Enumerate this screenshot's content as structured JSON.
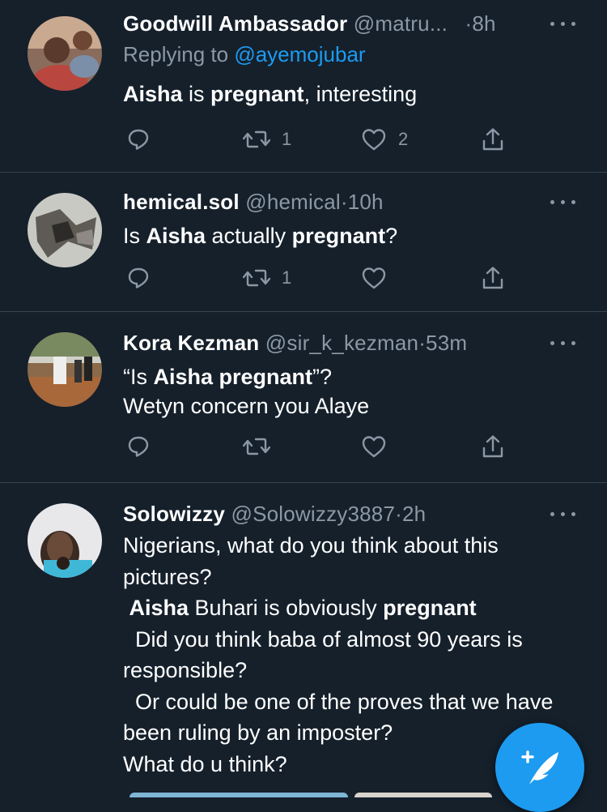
{
  "tweets": [
    {
      "name": "Goodwill Ambassador",
      "handle": "@matru...",
      "dot": "·",
      "time": "8h",
      "replying_prefix": "Replying to",
      "replying_to": "@ayemojubar",
      "body_parts": [
        {
          "t": "Aisha",
          "b": true
        },
        {
          "t": " is ",
          "b": false
        },
        {
          "t": "pregnant",
          "b": true
        },
        {
          "t": ", interesting",
          "b": false
        }
      ],
      "retweets": "1",
      "likes": "2"
    },
    {
      "name": "hemical.sol",
      "handle": "@hemical",
      "dot": "·",
      "time": "10h",
      "body_parts": [
        {
          "t": "Is ",
          "b": false
        },
        {
          "t": "Aisha",
          "b": true
        },
        {
          "t": " actually ",
          "b": false
        },
        {
          "t": "pregnant",
          "b": true
        },
        {
          "t": "?",
          "b": false
        }
      ],
      "retweets": "1",
      "likes": ""
    },
    {
      "name": "Kora Kezman",
      "handle": "@sir_k_kezman",
      "dot": "·",
      "time": "53m",
      "body_parts": [
        {
          "t": "“Is ",
          "b": false
        },
        {
          "t": "Aisha pregnant",
          "b": true
        },
        {
          "t": "”?\nWetyn concern you Alaye",
          "b": false
        }
      ],
      "retweets": "",
      "likes": ""
    },
    {
      "name": "Solowizzy",
      "handle": "@Solowizzy3887",
      "dot": "·",
      "time": "2h",
      "body_parts": [
        {
          "t": "Nigerians, what do you think about this pictures?\n ",
          "b": false
        },
        {
          "t": "Aisha",
          "b": true
        },
        {
          "t": " Buhari is obviously ",
          "b": false
        },
        {
          "t": "pregnant",
          "b": true
        },
        {
          "t": "\n  Did you think baba of almost 90 years is responsible?\n  Or could be one of the proves that we have been ruling by an imposter?\nWhat do u think?",
          "b": false
        }
      ]
    }
  ],
  "colors": {
    "background": "#15202b",
    "divider": "#38444d",
    "secondary_text": "#8b98a5",
    "accent": "#1d9bf0"
  },
  "icons": {
    "reply": "reply-icon",
    "retweet": "retweet-icon",
    "like": "heart-icon",
    "share": "share-icon",
    "more": "more-icon",
    "compose": "compose-tweet-icon"
  }
}
